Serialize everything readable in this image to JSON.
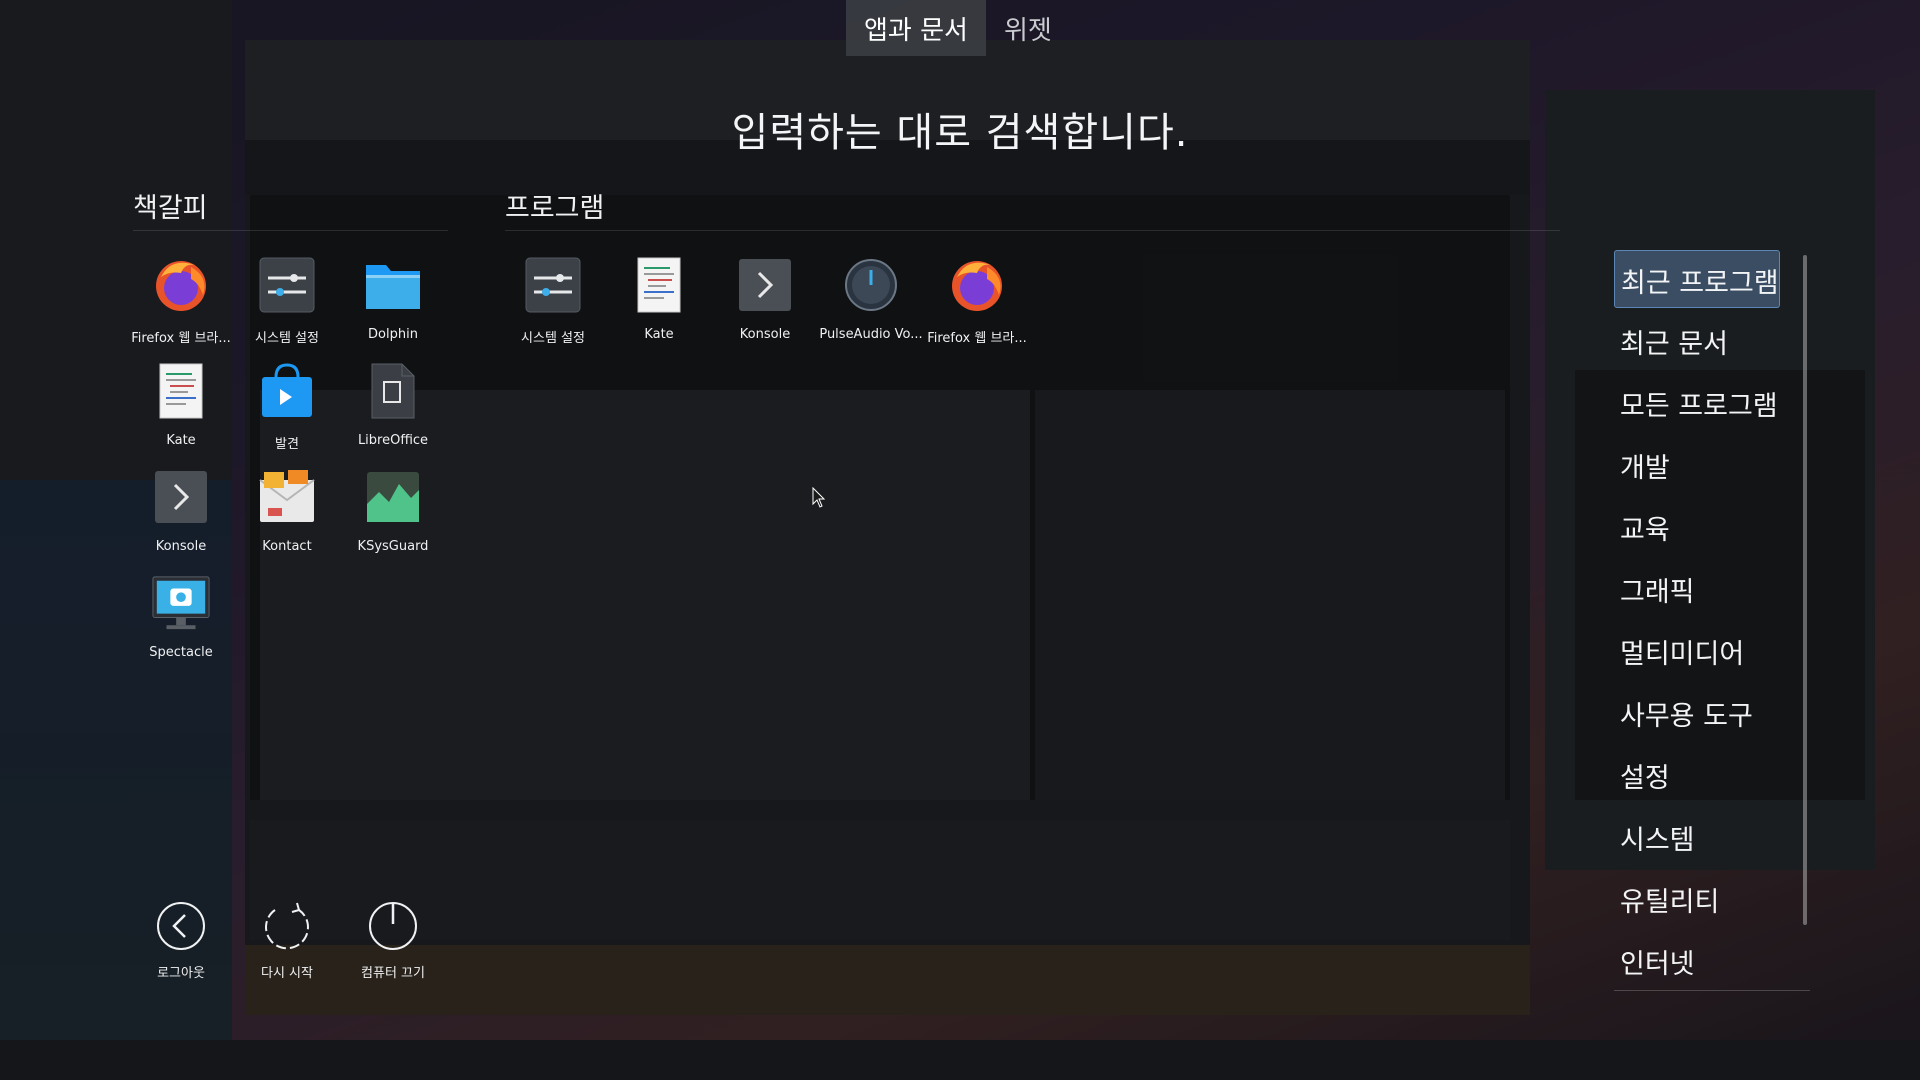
{
  "tabs": [
    {
      "label": "앱과 문서",
      "active": true
    },
    {
      "label": "위젯",
      "active": false
    }
  ],
  "search_hint": "입력하는 대로 검색합니다.",
  "favorites": {
    "title": "책갈피",
    "apps": [
      {
        "label": "Firefox 웹 브라...",
        "icon": "firefox-icon"
      },
      {
        "label": "시스템 설정",
        "icon": "system-settings-icon"
      },
      {
        "label": "Dolphin",
        "icon": "dolphin-folder-icon"
      },
      {
        "label": "Kate",
        "icon": "kate-icon"
      },
      {
        "label": "발견",
        "icon": "discover-icon"
      },
      {
        "label": "LibreOffice",
        "icon": "libreoffice-icon"
      },
      {
        "label": "Konsole",
        "icon": "konsole-icon"
      },
      {
        "label": "Kontact",
        "icon": "kontact-icon"
      },
      {
        "label": "KSysGuard",
        "icon": "ksysguard-icon"
      },
      {
        "label": "Spectacle",
        "icon": "spectacle-icon"
      }
    ]
  },
  "programs": {
    "title": "프로그램",
    "apps": [
      {
        "label": "시스템 설정",
        "icon": "system-settings-icon"
      },
      {
        "label": "Kate",
        "icon": "kate-icon"
      },
      {
        "label": "Konsole",
        "icon": "konsole-icon"
      },
      {
        "label": "PulseAudio Vo...",
        "icon": "pulseaudio-icon"
      },
      {
        "label": "Firefox 웹 브라...",
        "icon": "firefox-icon"
      }
    ]
  },
  "power": [
    {
      "label": "로그아웃",
      "icon": "logout-icon"
    },
    {
      "label": "다시 시작",
      "icon": "restart-icon"
    },
    {
      "label": "컴퓨터 끄기",
      "icon": "shutdown-icon"
    }
  ],
  "categories": [
    {
      "label": "최근 프로그램",
      "selected": true
    },
    {
      "label": "최근 문서"
    },
    {
      "label": "모든 프로그램"
    },
    {
      "label": "개발"
    },
    {
      "label": "교육"
    },
    {
      "label": "그래픽"
    },
    {
      "label": "멀티미디어"
    },
    {
      "label": "사무용 도구"
    },
    {
      "label": "설정"
    },
    {
      "label": "시스템"
    },
    {
      "label": "유틸리티"
    },
    {
      "label": "인터넷"
    }
  ],
  "colors": {
    "selection_bg": "#3a4d63",
    "selection_border": "#5b86b5"
  }
}
